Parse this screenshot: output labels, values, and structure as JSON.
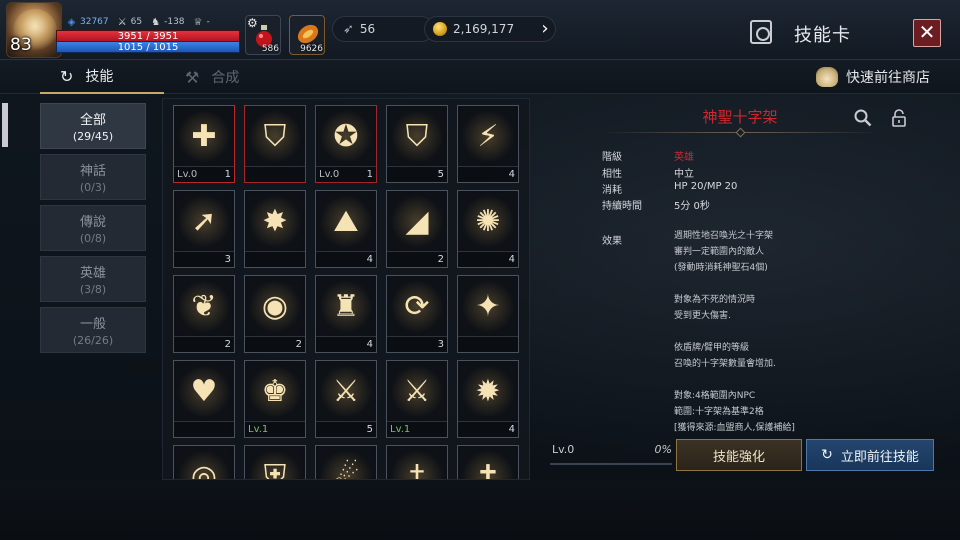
{
  "player": {
    "level": "83",
    "power": "32767",
    "attack": "65",
    "defense": "-138",
    "trophy": "-",
    "hp_text": "3951 / 3951",
    "mp_text": "1015 / 1015",
    "hp_ratio": 1.0,
    "mp_ratio": 1.0
  },
  "quick_items": [
    {
      "icon": "red-potion-icon",
      "count": "586"
    },
    {
      "icon": "orange-scroll-icon",
      "count": "9626"
    }
  ],
  "currency": {
    "feather": "56",
    "gold": "2,169,177"
  },
  "header": {
    "title": "技能卡",
    "close_label": "✕"
  },
  "tabs": [
    {
      "label": "技能",
      "active": true
    },
    {
      "label": "合成",
      "active": false
    }
  ],
  "shop_link": "快速前往商店",
  "categories": [
    {
      "name": "全部",
      "count": "(29/45)",
      "active": true
    },
    {
      "name": "神話",
      "count": "(0/3)",
      "active": false
    },
    {
      "name": "傳說",
      "count": "(0/8)",
      "active": false
    },
    {
      "name": "英雄",
      "count": "(3/8)",
      "active": false
    },
    {
      "name": "一般",
      "count": "(26/26)",
      "active": false
    }
  ],
  "skills": [
    {
      "icon": "holy-cross-icon",
      "glyph": "✚",
      "lv": "Lv.0",
      "lv_color": "normal",
      "count": "1",
      "border": "selected"
    },
    {
      "icon": "flame-shield-icon",
      "glyph": "⛉",
      "lv": "",
      "lv_color": "normal",
      "count": "",
      "border": "red"
    },
    {
      "icon": "star-ring-icon",
      "glyph": "✪",
      "lv": "Lv.0",
      "lv_color": "normal",
      "count": "1",
      "border": "red"
    },
    {
      "icon": "shield-icon",
      "glyph": "⛉",
      "lv": "",
      "lv_color": "normal",
      "count": "5",
      "border": "normal"
    },
    {
      "icon": "lightning-icon",
      "glyph": "⚡",
      "lv": "",
      "lv_color": "normal",
      "count": "4",
      "border": "normal"
    },
    {
      "icon": "arrow-arc-icon",
      "glyph": "➚",
      "lv": "",
      "lv_color": "normal",
      "count": "3",
      "border": "normal"
    },
    {
      "icon": "sparkle-burst-icon",
      "glyph": "✸",
      "lv": "",
      "lv_color": "normal",
      "count": "",
      "border": "normal"
    },
    {
      "icon": "altar-icon",
      "glyph": "⛰",
      "lv": "",
      "lv_color": "normal",
      "count": "4",
      "border": "normal"
    },
    {
      "icon": "eye-icon",
      "glyph": "◢",
      "lv": "",
      "lv_color": "normal",
      "count": "2",
      "border": "normal"
    },
    {
      "icon": "dragon-head-icon",
      "glyph": "✺",
      "lv": "",
      "lv_color": "normal",
      "count": "4",
      "border": "normal"
    },
    {
      "icon": "green-dash-icon",
      "glyph": "❦",
      "lv": "",
      "lv_color": "normal",
      "count": "2",
      "border": "normal"
    },
    {
      "icon": "orb-pedestal-icon",
      "glyph": "◉",
      "lv": "",
      "lv_color": "normal",
      "count": "2",
      "border": "normal"
    },
    {
      "icon": "armored-figure-icon",
      "glyph": "♜",
      "lv": "",
      "lv_color": "normal",
      "count": "4",
      "border": "normal"
    },
    {
      "icon": "cycle-arrows-icon",
      "glyph": "⟳",
      "lv": "",
      "lv_color": "normal",
      "count": "3",
      "border": "normal"
    },
    {
      "icon": "sparkle-ground-icon",
      "glyph": "✦",
      "lv": "",
      "lv_color": "normal",
      "count": "",
      "border": "normal"
    },
    {
      "icon": "heart-glow-icon",
      "glyph": "♥",
      "lv": "",
      "lv_color": "normal",
      "count": "",
      "border": "normal"
    },
    {
      "icon": "helmet-icon",
      "glyph": "♚",
      "lv": "Lv.1",
      "lv_color": "green",
      "count": "",
      "border": "normal"
    },
    {
      "icon": "sword-icon",
      "glyph": "⚔",
      "lv": "",
      "lv_color": "normal",
      "count": "5",
      "border": "normal"
    },
    {
      "icon": "sword-burst-icon",
      "glyph": "⚔",
      "lv": "Lv.1",
      "lv_color": "green",
      "count": "",
      "border": "normal"
    },
    {
      "icon": "star-burst-icon",
      "glyph": "✹",
      "lv": "",
      "lv_color": "normal",
      "count": "4",
      "border": "normal"
    },
    {
      "icon": "whirlwind-icon",
      "glyph": "◎",
      "lv": "",
      "lv_color": "normal",
      "count": "",
      "border": "normal"
    },
    {
      "icon": "shield-cross-icon",
      "glyph": "⛨",
      "lv": "",
      "lv_color": "normal",
      "count": "",
      "border": "normal"
    },
    {
      "icon": "blue-arc-icon",
      "glyph": "☄",
      "lv": "",
      "lv_color": "normal",
      "count": "",
      "border": "normal"
    },
    {
      "icon": "sword-pillar-icon",
      "glyph": "†",
      "lv": "",
      "lv_color": "normal",
      "count": "",
      "border": "normal"
    },
    {
      "icon": "red-sword-icon",
      "glyph": "✝",
      "lv": "",
      "lv_color": "normal",
      "count": "",
      "border": "normal"
    }
  ],
  "detail": {
    "name": "神聖十字架",
    "rows": [
      {
        "key": "階級",
        "value": "英雄",
        "highlight": true
      },
      {
        "key": "相性",
        "value": "中立",
        "highlight": false
      },
      {
        "key": "消耗",
        "value": "HP 20/MP 20",
        "highlight": false
      },
      {
        "key": "持續時間",
        "value": "5分 0秒",
        "highlight": false
      }
    ],
    "effect_label": "效果",
    "effect_lines": [
      "週期性地召喚光之十字架",
      "審判一定範圍內的敵人",
      "(發動時消耗神聖石4個)",
      "",
      "對象為不死的情況時",
      "受到更大傷害.",
      "",
      "依盾牌/臂甲的等級",
      "召喚的十字架數量會增加.",
      "",
      "對象:4格範圍內NPC",
      "範圍:十字架為基準2格",
      "[獲得來源:血盟商人,保護補給]"
    ],
    "progress_level": "Lv.0",
    "progress_pct": "0%",
    "progress_ratio": 0,
    "enhance_label": "技能強化",
    "goto_label": "立即前往技能"
  },
  "colors": {
    "accent_gold": "#c9a769",
    "name_red": "#d0272f",
    "hp_red": "#d0202b",
    "mp_blue": "#2f74d6",
    "level_green": "#7fc25d"
  }
}
